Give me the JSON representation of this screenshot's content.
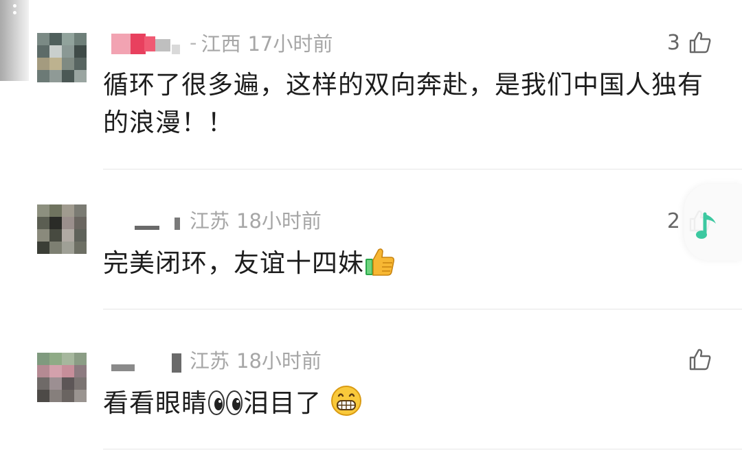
{
  "comments": [
    {
      "location": "江西",
      "time": "17小时前",
      "likes": "3",
      "text": "循环了很多遍，这样的双向奔赴，是我们中国人独有的浪漫！！"
    },
    {
      "location": "江苏",
      "time": "18小时前",
      "likes": "2",
      "text": "完美闭环，友谊十四妹"
    },
    {
      "location": "江苏",
      "time": "18小时前",
      "likes": "",
      "text_a": "看看眼睛",
      "text_b": "泪目了"
    }
  ],
  "icons": {
    "like": "thumbs-up-outline-icon",
    "emoji_thumbs_up": "thumbs-up-emoji-icon",
    "emoji_eyes": "eyes-emoji-icon",
    "emoji_grin": "grinning-emoji-icon",
    "music": "music-note-icon"
  },
  "colors": {
    "meta_text": "#a6a6a6",
    "body_text": "#1d1d1d",
    "music_accent": "#3cc8a0"
  }
}
